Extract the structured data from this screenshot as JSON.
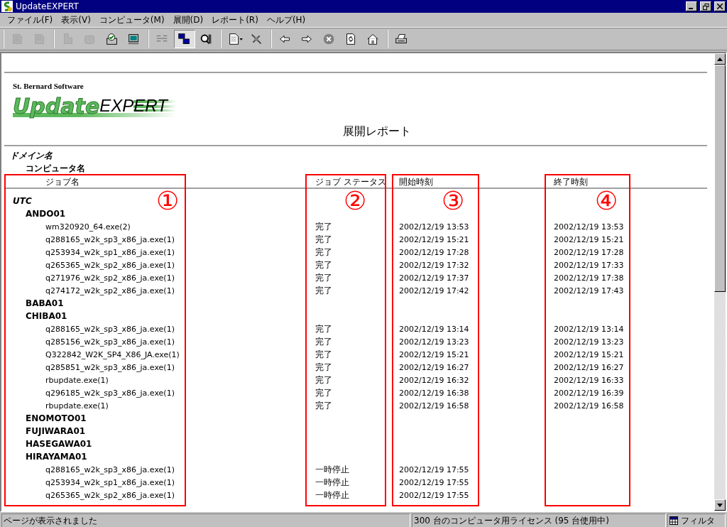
{
  "window": {
    "title": "UpdateEXPERT"
  },
  "menu": [
    "ファイル(F)",
    "表示(V)",
    "コンピュータ(M)",
    "展開(D)",
    "レポート(R)",
    "ヘルプ(H)"
  ],
  "toolbar": [
    [
      {
        "disabled": true,
        "pressed": false
      },
      {
        "disabled": true,
        "pressed": false
      }
    ],
    [
      {
        "disabled": true,
        "pressed": false
      },
      {
        "disabled": true,
        "pressed": false
      },
      {
        "disabled": false,
        "pressed": false
      },
      {
        "disabled": false,
        "pressed": false
      }
    ],
    [
      {
        "disabled": false,
        "pressed": false
      },
      {
        "disabled": false,
        "pressed": true
      },
      {
        "disabled": false,
        "pressed": false
      }
    ],
    [
      {
        "disabled": false,
        "pressed": false
      },
      {
        "disabled": false,
        "pressed": false
      }
    ],
    [
      {
        "disabled": false,
        "pressed": false
      },
      {
        "disabled": false,
        "pressed": false
      },
      {
        "disabled": false,
        "pressed": false
      },
      {
        "disabled": false,
        "pressed": false
      },
      {
        "disabled": false,
        "pressed": false
      }
    ],
    [
      {
        "disabled": false,
        "pressed": false
      }
    ]
  ],
  "report": {
    "vendor": "St. Bernard Software",
    "logo_bold": "Update",
    "logo_light": "EXPERT",
    "title": "展開レポート",
    "domain_label": "ドメイン名",
    "computer_label": "コンピュータ名",
    "columns": [
      "ジョブ名",
      "ジョブ ステータス",
      "開始時刻",
      "終了時刻"
    ],
    "domains": [
      {
        "name": "UTC",
        "computers": [
          {
            "name": "ANDO01",
            "jobs": [
              {
                "name": "wm320920_64.exe(2)",
                "status": "完了",
                "start": "2002/12/19 13:53",
                "end": "2002/12/19 13:53"
              },
              {
                "name": "q288165_w2k_sp3_x86_ja.exe(1)",
                "status": "完了",
                "start": "2002/12/19 15:21",
                "end": "2002/12/19 15:21"
              },
              {
                "name": "q253934_w2k_sp1_x86_ja.exe(1)",
                "status": "完了",
                "start": "2002/12/19 17:28",
                "end": "2002/12/19 17:28"
              },
              {
                "name": "q265365_w2k_sp2_x86_ja.exe(1)",
                "status": "完了",
                "start": "2002/12/19 17:32",
                "end": "2002/12/19 17:33"
              },
              {
                "name": "q271976_w2k_sp2_x86_ja.exe(1)",
                "status": "完了",
                "start": "2002/12/19 17:37",
                "end": "2002/12/19 17:38"
              },
              {
                "name": "q274172_w2k_sp2_x86_ja.exe(1)",
                "status": "完了",
                "start": "2002/12/19 17:42",
                "end": "2002/12/19 17:43"
              }
            ]
          },
          {
            "name": "BABA01"
          },
          {
            "name": "CHIBA01",
            "jobs": [
              {
                "name": "q288165_w2k_sp3_x86_ja.exe(1)",
                "status": "完了",
                "start": "2002/12/19 13:14",
                "end": "2002/12/19 13:14"
              },
              {
                "name": "q285156_w2k_sp3_x86_ja.exe(1)",
                "status": "完了",
                "start": "2002/12/19 13:23",
                "end": "2002/12/19 13:23"
              },
              {
                "name": "Q322842_W2K_SP4_X86_JA.exe(1)",
                "status": "完了",
                "start": "2002/12/19 15:21",
                "end": "2002/12/19 15:21"
              },
              {
                "name": "q285851_w2k_sp3_x86_ja.exe(1)",
                "status": "完了",
                "start": "2002/12/19 16:27",
                "end": "2002/12/19 16:27"
              },
              {
                "name": "rbupdate.exe(1)",
                "status": "完了",
                "start": "2002/12/19 16:32",
                "end": "2002/12/19 16:33"
              },
              {
                "name": "q296185_w2k_sp3_x86_ja.exe(1)",
                "status": "完了",
                "start": "2002/12/19 16:38",
                "end": "2002/12/19 16:39"
              },
              {
                "name": "rbupdate.exe(1)",
                "status": "完了",
                "start": "2002/12/19 16:58",
                "end": "2002/12/19 16:58"
              }
            ]
          },
          {
            "name": "ENOMOTO01"
          },
          {
            "name": "FUJIWARA01"
          },
          {
            "name": "HASEGAWA01"
          },
          {
            "name": "HIRAYAMA01",
            "jobs": [
              {
                "name": "q288165_w2k_sp3_x86_ja.exe(1)",
                "status": "一時停止",
                "start": "2002/12/19 17:55"
              },
              {
                "name": "q253934_w2k_sp1_x86_ja.exe(1)",
                "status": "一時停止",
                "start": "2002/12/19 17:55"
              },
              {
                "name": "q265365_w2k_sp2_x86_ja.exe(1)",
                "status": "一時停止",
                "start": "2002/12/19 17:55"
              }
            ]
          }
        ]
      }
    ]
  },
  "annotations": [
    "①",
    "②",
    "③",
    "④"
  ],
  "status_bar": {
    "message": "ページが表示されました",
    "license": "300 台のコンピュータ用ライセンス (95 台使用中)",
    "filter": "フィルタ"
  }
}
